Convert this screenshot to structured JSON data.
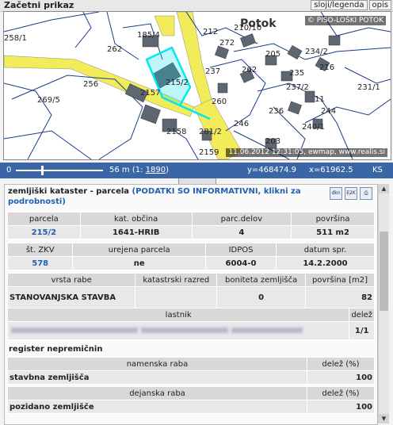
{
  "topbar": {
    "title": "Začetni prikaz",
    "btn1": "sloji/legenda",
    "btn2": "opis"
  },
  "map": {
    "place_name": "Potok",
    "copyright": "© PISO-LOŠKI POTOK",
    "stamp": "11.06.2012 12:31:05, ewmap, www.realis.si",
    "labels": [
      "215/2",
      "262",
      "256",
      "269/5",
      "258/1",
      "2157",
      "185/4",
      "212",
      "272",
      "210/10",
      "205",
      "234/2",
      "216",
      "231/1",
      "237",
      "262",
      "235",
      "11",
      "237/2",
      "260",
      "281/2",
      "246",
      "240/1",
      "203",
      "2159",
      "2158",
      "236",
      "244"
    ]
  },
  "scale": {
    "left_value": "0",
    "distance": "56 m (1: ",
    "ratio": "1890",
    "ratio_close": ")",
    "y": "y=468474.9",
    "x": "x=61962.5",
    "crs": "KS"
  },
  "panel": {
    "heading": "zemljiški kataster - parcela",
    "heading_link": "(PODATKI SO INFORMATIVNI, klikni za podrobnosti)",
    "icons": [
      "dkn-icon",
      "e2k-icon",
      "print-icon"
    ],
    "icon_labels": [
      "dkn",
      "E2K",
      "⎙"
    ],
    "t1_headers": [
      "parcela",
      "kat. občina",
      "parc.delov",
      "površina"
    ],
    "t1_values": [
      "215/2",
      "1641-HRIB",
      "4",
      "511 m2"
    ],
    "t2_headers": [
      "št. ZKV",
      "urejena parcela",
      "IDPOS",
      "datum spr."
    ],
    "t2_values": [
      "578",
      "ne",
      "6004-0",
      "14.2.2000"
    ],
    "t3_headers": [
      "vrsta rabe",
      "katastrski razred",
      "boniteta zemljišča",
      "površina [m2]"
    ],
    "t3_values": [
      "STANOVANJSKA STAVBA",
      "",
      "0",
      "82"
    ],
    "owner_headers": [
      "lastnik",
      "delež"
    ],
    "owner_share": "1/1",
    "register_title": "register nepremičnin",
    "r1_headers": [
      "namenska raba",
      "delež (%)"
    ],
    "r1_values": [
      "stavbna zemljišča",
      "100"
    ],
    "r2_headers": [
      "dejanska raba",
      "delež (%)"
    ],
    "r2_values": [
      "pozidano zemljišče",
      "100"
    ]
  }
}
